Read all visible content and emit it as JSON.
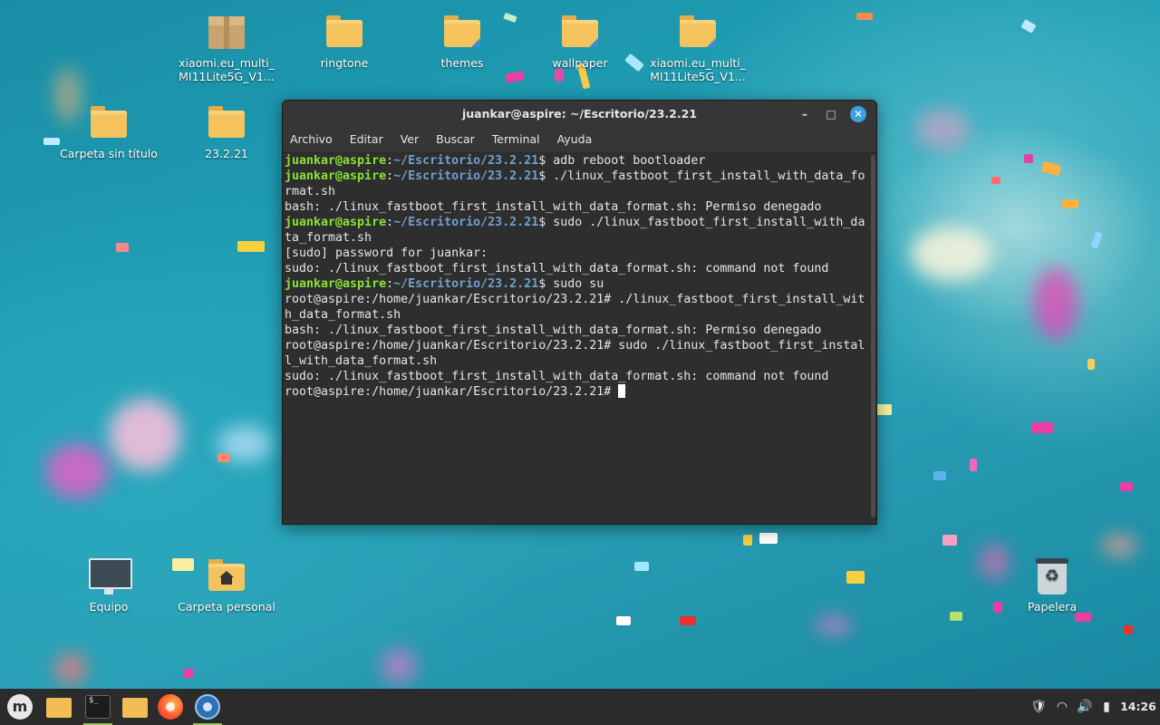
{
  "desktop": {
    "icons": [
      {
        "label": "xiaomi.eu_multi_\nMI11Lite5G_V1...",
        "type": "archive"
      },
      {
        "label": "ringtone",
        "type": "folder"
      },
      {
        "label": "themes",
        "type": "folder-link"
      },
      {
        "label": "wallpaper",
        "type": "folder"
      },
      {
        "label": "xiaomi.eu_multi_\nMI11Lite5G_V1...",
        "type": "folder"
      },
      {
        "label": "Carpeta sin título",
        "type": "folder"
      },
      {
        "label": "23.2.21",
        "type": "folder"
      },
      {
        "label": "Equipo",
        "type": "computer"
      },
      {
        "label": "Carpeta personal",
        "type": "home-folder"
      },
      {
        "label": "Papelera",
        "type": "trash"
      }
    ]
  },
  "terminal": {
    "title": "juankar@aspire: ~/Escritorio/23.2.21",
    "menu": [
      "Archivo",
      "Editar",
      "Ver",
      "Buscar",
      "Terminal",
      "Ayuda"
    ],
    "buttons": {
      "minimize": "–",
      "maximize": "□",
      "close": "✕"
    },
    "lines": [
      {
        "user": "juankar@aspire",
        "path": "~/Escritorio/23.2.21",
        "text": "$ adb reboot bootloader"
      },
      {
        "user": "juankar@aspire",
        "path": "~/Escritorio/23.2.21",
        "text": "$ ./linux_fastboot_first_install_with_data_fo"
      },
      {
        "text": "rmat.sh"
      },
      {
        "text": "bash: ./linux_fastboot_first_install_with_data_format.sh: Permiso denegado"
      },
      {
        "user": "juankar@aspire",
        "path": "~/Escritorio/23.2.21",
        "text": "$ sudo ./linux_fastboot_first_install_with_da"
      },
      {
        "text": "ta_format.sh"
      },
      {
        "text": "[sudo] password for juankar:"
      },
      {
        "text": "sudo: ./linux_fastboot_first_install_with_data_format.sh: command not found"
      },
      {
        "user": "juankar@aspire",
        "path": "~/Escritorio/23.2.21",
        "text": "$ sudo su"
      },
      {
        "text": "root@aspire:/home/juankar/Escritorio/23.2.21# ./linux_fastboot_first_install_wit"
      },
      {
        "text": "h_data_format.sh"
      },
      {
        "text": "bash: ./linux_fastboot_first_install_with_data_format.sh: Permiso denegado"
      },
      {
        "text": "root@aspire:/home/juankar/Escritorio/23.2.21# sudo ./linux_fastboot_first_instal"
      },
      {
        "text": "l_with_data_format.sh"
      },
      {
        "text": "sudo: ./linux_fastboot_first_install_with_data_format.sh: command not found"
      },
      {
        "text": "root@aspire:/home/juankar/Escritorio/23.2.21# ",
        "cursor": true
      }
    ],
    "colors": {
      "user": "#8ae234",
      "path": "#729fcf",
      "background": "#2e2e2e"
    }
  },
  "taskbar": {
    "apps": [
      {
        "name": "menu-button",
        "icon": "mint-logo-icon"
      },
      {
        "name": "files",
        "icon": "folder-icon"
      },
      {
        "name": "terminal",
        "icon": "terminal-icon",
        "active": true,
        "glyph": "$_"
      },
      {
        "name": "file-manager",
        "icon": "folder-icon"
      },
      {
        "name": "firefox",
        "icon": "firefox-icon"
      },
      {
        "name": "chromium",
        "icon": "chromium-icon"
      }
    ],
    "tray": {
      "shield": "🛡",
      "wifi": "◠",
      "volume": "🔊",
      "battery": "▮",
      "clock": "14:26"
    }
  }
}
